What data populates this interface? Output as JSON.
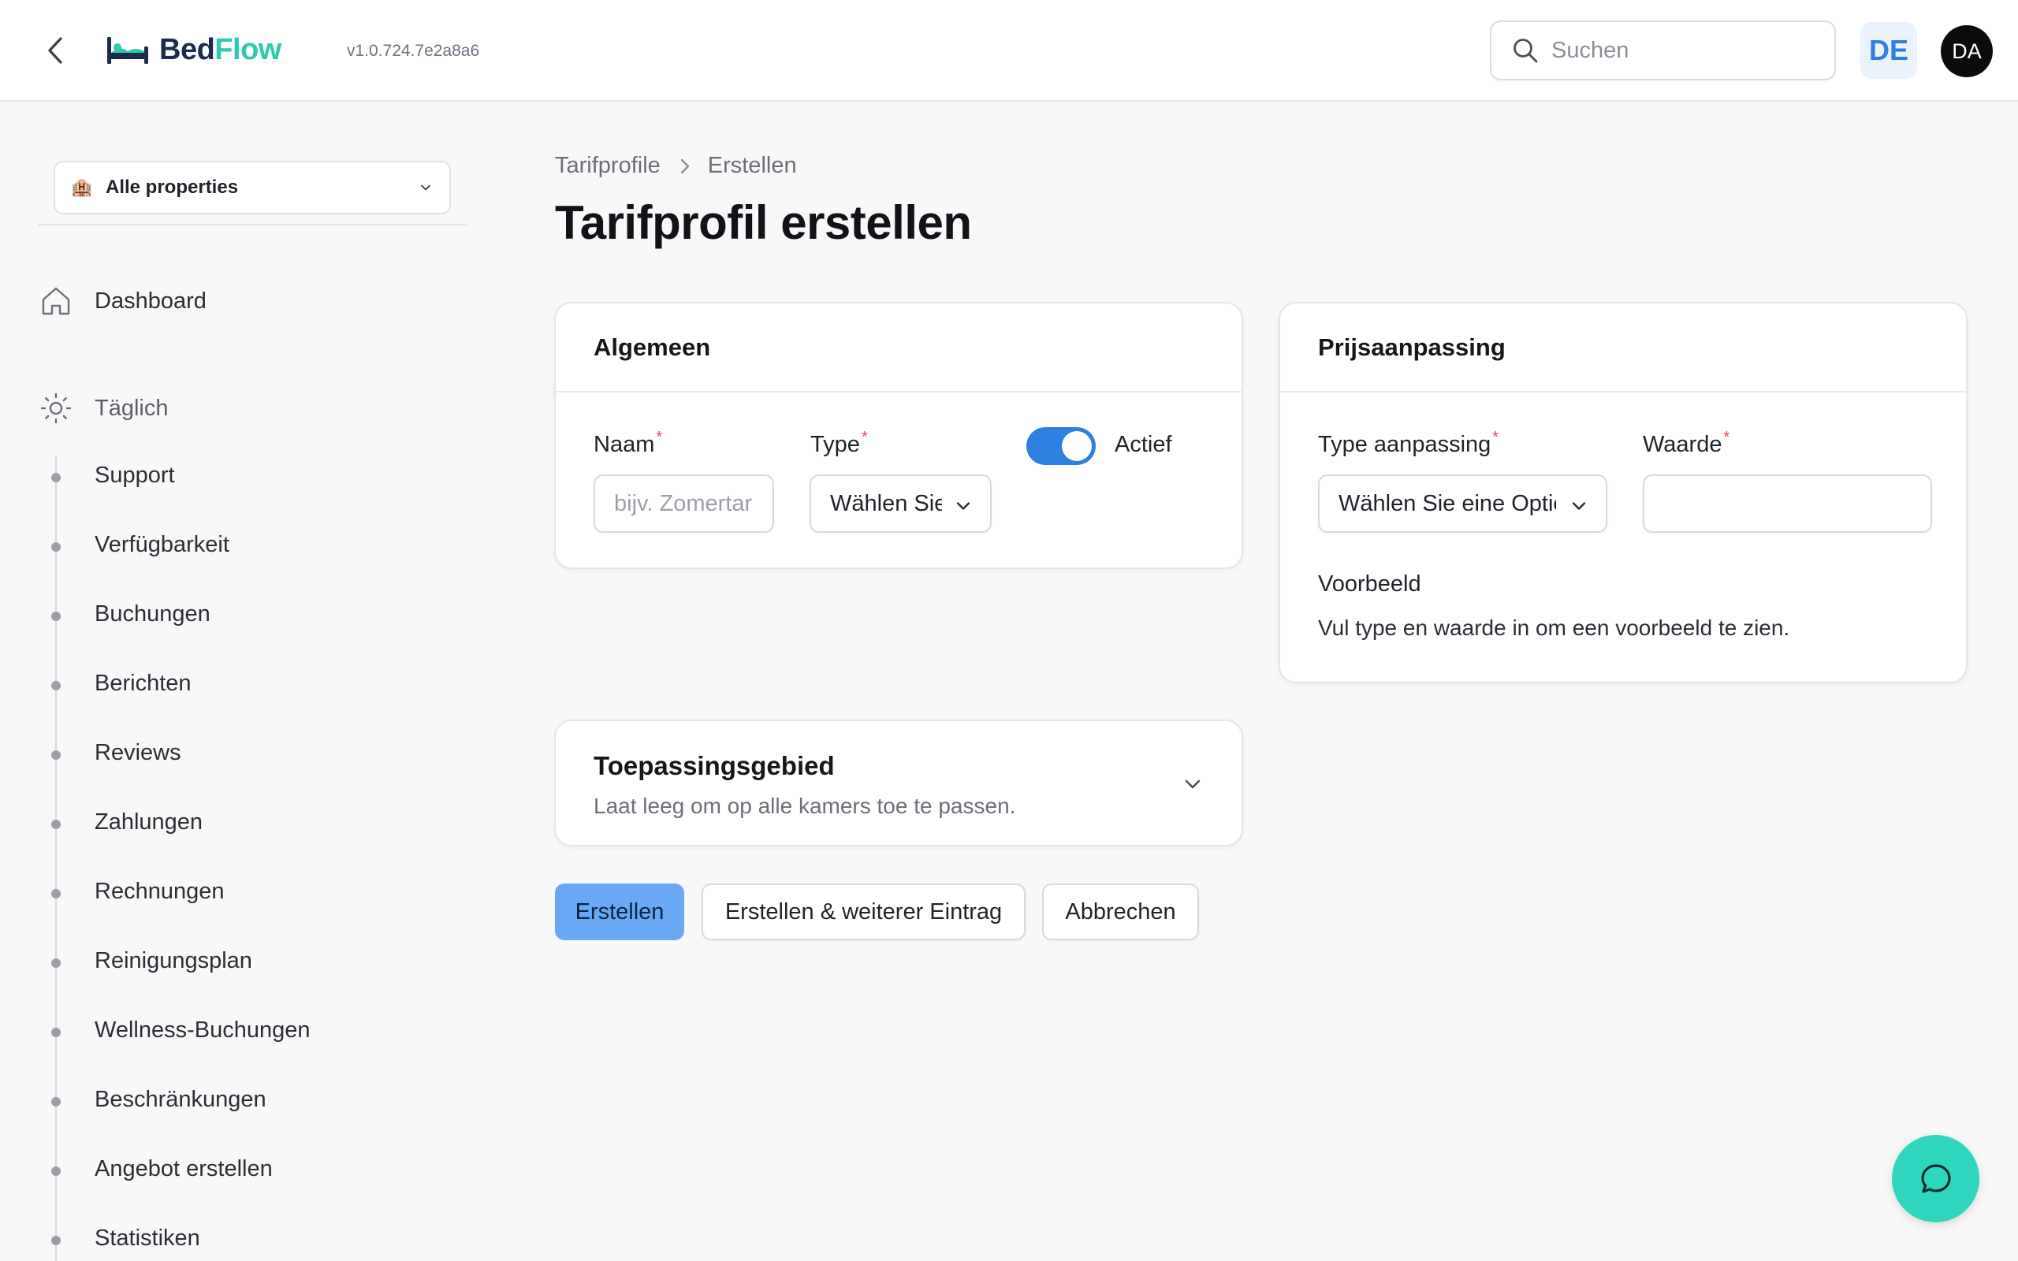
{
  "header": {
    "logo_part1": "Bed",
    "logo_part2": "Flow",
    "version": "v1.0.724.7e2a8a6",
    "search_placeholder": "Suchen",
    "language": "DE",
    "avatar_initials": "DA"
  },
  "sidebar": {
    "property_selector": "Alle properties",
    "dashboard": "Dashboard",
    "section_daily": "Täglich",
    "items": [
      {
        "label": "Support"
      },
      {
        "label": "Verfügbarkeit"
      },
      {
        "label": "Buchungen"
      },
      {
        "label": "Berichten"
      },
      {
        "label": "Reviews"
      },
      {
        "label": "Zahlungen"
      },
      {
        "label": "Rechnungen"
      },
      {
        "label": "Reinigungsplan"
      },
      {
        "label": "Wellness-Buchungen"
      },
      {
        "label": "Beschränkungen"
      },
      {
        "label": "Angebot erstellen"
      },
      {
        "label": "Statistiken"
      }
    ]
  },
  "breadcrumb": {
    "parent": "Tarifprofile",
    "current": "Erstellen"
  },
  "page_title": "Tarifprofil erstellen",
  "general_card": {
    "title": "Algemeen",
    "name_label": "Naam",
    "name_placeholder": "bijv. Zomertarief",
    "name_value": "",
    "type_label": "Type",
    "type_value": "Wählen Sie eine Option",
    "active_label": "Actief",
    "active": true
  },
  "price_card": {
    "title": "Prijsaanpassing",
    "adjust_type_label": "Type aanpassing",
    "adjust_type_value": "Wählen Sie eine Option",
    "value_label": "Waarde",
    "value_value": "",
    "preview_title": "Voorbeeld",
    "preview_text": "Vul type en waarde in om een voorbeeld te zien."
  },
  "scope_card": {
    "title": "Toepassingsgebied",
    "subtitle": "Laat leeg om op alle kamers toe te passen."
  },
  "actions": {
    "create": "Erstellen",
    "create_another": "Erstellen & weiterer Eintrag",
    "cancel": "Abbrechen"
  },
  "colors": {
    "accent": "#2d7fe0",
    "primary_button": "#6aa8f5",
    "brand_teal": "#2ec8b0",
    "chat_fab": "#2ed6bd",
    "required": "#e5484d"
  },
  "icons": {
    "back": "chevron-left-icon",
    "logo": "bed-icon",
    "search": "search-icon",
    "property": "hotel-icon",
    "dashboard": "home-icon",
    "daily": "sun-icon",
    "chat": "chat-bubble-icon"
  }
}
